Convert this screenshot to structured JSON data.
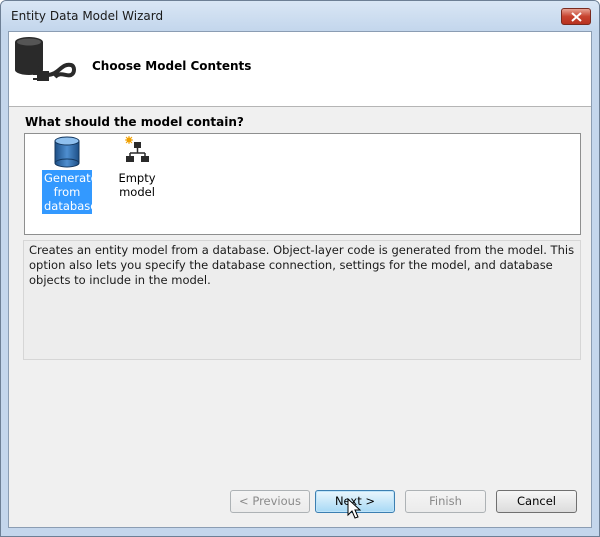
{
  "window": {
    "title": "Entity Data Model Wizard"
  },
  "header": {
    "title": "Choose Model Contents"
  },
  "question": "What should the model contain?",
  "model_options": [
    {
      "label_lines": [
        "Generate",
        "from",
        "database"
      ],
      "icon": "database-icon",
      "selected": true
    },
    {
      "label_lines": [
        "Empty model"
      ],
      "icon": "hierarchy-icon",
      "selected": false
    }
  ],
  "description": "Creates an entity model from a database. Object-layer code is generated from the model. This option also lets you specify the database connection, settings for the model, and database objects to include in the model.",
  "buttons": {
    "previous": "< Previous",
    "next": "Next >",
    "finish": "Finish",
    "cancel": "Cancel"
  },
  "colors": {
    "selection": "#3399ff",
    "titlebar": "#c4d6ec",
    "close_button": "#c7432f"
  }
}
